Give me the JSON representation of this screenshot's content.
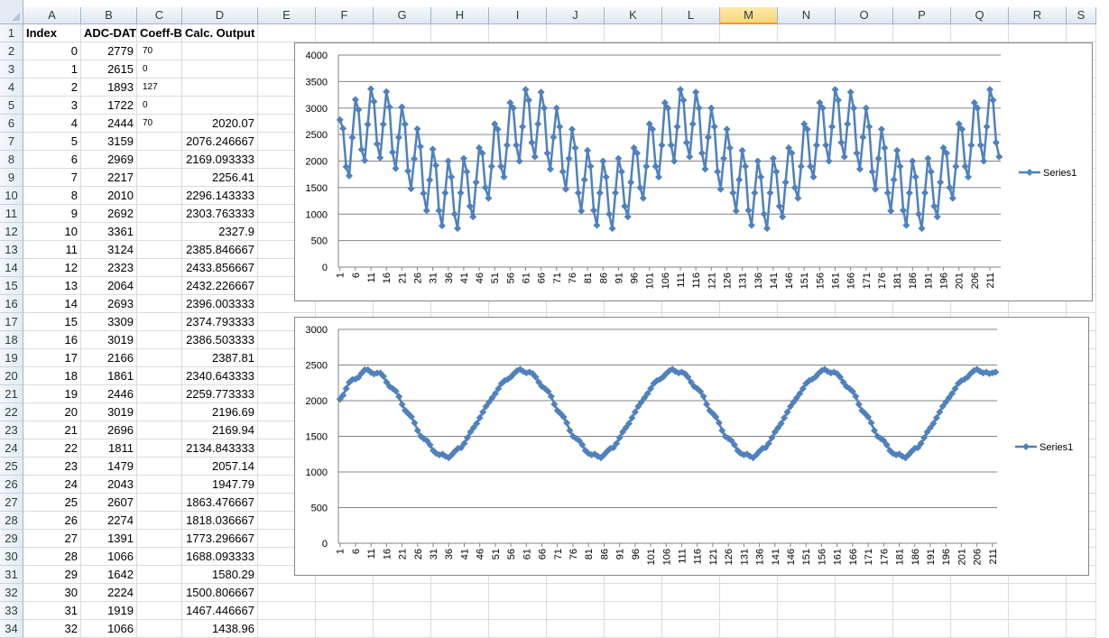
{
  "columns": [
    "A",
    "B",
    "C",
    "D",
    "E",
    "F",
    "G",
    "H",
    "I",
    "J",
    "K",
    "L",
    "M",
    "N",
    "O",
    "P",
    "Q",
    "R",
    "S"
  ],
  "active_column": "M",
  "headers": {
    "index": "Index",
    "adc": "ADC-DATA",
    "coeff": "Coeff-B",
    "calc": "Calc. Output"
  },
  "rows": [
    {
      "r": "1"
    },
    {
      "r": "2",
      "a": "0",
      "b": "2779",
      "c": "70",
      "d": ""
    },
    {
      "r": "3",
      "a": "1",
      "b": "2615",
      "c": "0",
      "d": ""
    },
    {
      "r": "4",
      "a": "2",
      "b": "1893",
      "c": "127",
      "d": ""
    },
    {
      "r": "5",
      "a": "3",
      "b": "1722",
      "c": "0",
      "d": ""
    },
    {
      "r": "6",
      "a": "4",
      "b": "2444",
      "c": "70",
      "d": "2020.07"
    },
    {
      "r": "7",
      "a": "5",
      "b": "3159",
      "c": "",
      "d": "2076.246667"
    },
    {
      "r": "8",
      "a": "6",
      "b": "2969",
      "c": "",
      "d": "2169.093333"
    },
    {
      "r": "9",
      "a": "7",
      "b": "2217",
      "c": "",
      "d": "2256.41"
    },
    {
      "r": "10",
      "a": "8",
      "b": "2010",
      "c": "",
      "d": "2296.143333"
    },
    {
      "r": "11",
      "a": "9",
      "b": "2692",
      "c": "",
      "d": "2303.763333"
    },
    {
      "r": "12",
      "a": "10",
      "b": "3361",
      "c": "",
      "d": "2327.9"
    },
    {
      "r": "13",
      "a": "11",
      "b": "3124",
      "c": "",
      "d": "2385.846667"
    },
    {
      "r": "14",
      "a": "12",
      "b": "2323",
      "c": "",
      "d": "2433.856667"
    },
    {
      "r": "15",
      "a": "13",
      "b": "2064",
      "c": "",
      "d": "2432.226667"
    },
    {
      "r": "16",
      "a": "14",
      "b": "2693",
      "c": "",
      "d": "2396.003333"
    },
    {
      "r": "17",
      "a": "15",
      "b": "3309",
      "c": "",
      "d": "2374.793333"
    },
    {
      "r": "18",
      "a": "16",
      "b": "3019",
      "c": "",
      "d": "2386.503333"
    },
    {
      "r": "19",
      "a": "17",
      "b": "2166",
      "c": "",
      "d": "2387.81"
    },
    {
      "r": "20",
      "a": "18",
      "b": "1861",
      "c": "",
      "d": "2340.643333"
    },
    {
      "r": "21",
      "a": "19",
      "b": "2446",
      "c": "",
      "d": "2259.773333"
    },
    {
      "r": "22",
      "a": "20",
      "b": "3019",
      "c": "",
      "d": "2196.69"
    },
    {
      "r": "23",
      "a": "21",
      "b": "2696",
      "c": "",
      "d": "2169.94"
    },
    {
      "r": "24",
      "a": "22",
      "b": "1811",
      "c": "",
      "d": "2134.843333"
    },
    {
      "r": "25",
      "a": "23",
      "b": "1479",
      "c": "",
      "d": "2057.14"
    },
    {
      "r": "26",
      "a": "24",
      "b": "2043",
      "c": "",
      "d": "1947.79"
    },
    {
      "r": "27",
      "a": "25",
      "b": "2607",
      "c": "",
      "d": "1863.476667"
    },
    {
      "r": "28",
      "a": "26",
      "b": "2274",
      "c": "",
      "d": "1818.036667"
    },
    {
      "r": "29",
      "a": "27",
      "b": "1391",
      "c": "",
      "d": "1773.296667"
    },
    {
      "r": "30",
      "a": "28",
      "b": "1066",
      "c": "",
      "d": "1688.093333"
    },
    {
      "r": "31",
      "a": "29",
      "b": "1642",
      "c": "",
      "d": "1580.29"
    },
    {
      "r": "32",
      "a": "30",
      "b": "2224",
      "c": "",
      "d": "1500.806667"
    },
    {
      "r": "33",
      "a": "31",
      "b": "1919",
      "c": "",
      "d": "1467.446667"
    },
    {
      "r": "34",
      "a": "32",
      "b": "1066",
      "c": "",
      "d": "1438.96"
    }
  ],
  "colors": {
    "series": "#4f81bd",
    "grid": "#868686",
    "header_bg": "#e4ebf4",
    "active_header": "#f9d67a"
  },
  "chart_data": [
    {
      "type": "line",
      "series": [
        {
          "name": "Series1",
          "values": [
            2779,
            2615,
            1893,
            1722,
            2444,
            3159,
            2969,
            2217,
            2010,
            2692,
            3361,
            3124,
            2323,
            2064,
            2693,
            3309,
            3019,
            2166,
            1861,
            2446,
            3019,
            2696,
            1811,
            1479,
            2043,
            2607,
            2274,
            1391,
            1066,
            1642,
            2224,
            1919,
            1066,
            780,
            1400,
            2000,
            1700,
            1000,
            730,
            1400,
            2050,
            1800,
            1150,
            950,
            1600,
            2250,
            2150,
            1500,
            1300,
            1900,
            2700,
            2600,
            1900,
            1700,
            2300,
            3100,
            3000,
            2300,
            2000,
            2650,
            3350,
            3150,
            2350,
            2080,
            2700,
            3300,
            3000,
            2150,
            1850,
            2450,
            3000,
            2650,
            1800,
            1470,
            2050,
            2600,
            2250,
            1400,
            1060,
            1650,
            2200,
            1900,
            1070,
            790,
            1400,
            2000,
            1700,
            1000,
            730,
            1400,
            2050,
            1800,
            1150,
            950,
            1600,
            2250,
            2150,
            1500,
            1300,
            1900,
            2700,
            2600,
            1900,
            1700,
            2300,
            3100,
            3000,
            2300,
            2000,
            2650,
            3350,
            3150,
            2350,
            2080,
            2700,
            3300,
            3000,
            2150,
            1850,
            2450,
            3000,
            2650,
            1800,
            1470,
            2050,
            2600,
            2250,
            1400,
            1060,
            1650,
            2200,
            1900,
            1070,
            790,
            1400,
            2000,
            1700,
            1000,
            730,
            1400,
            2050,
            1800,
            1150,
            950,
            1600,
            2250,
            2150,
            1500,
            1300,
            1900,
            2700,
            2600,
            1900,
            1700,
            2300,
            3100,
            3000,
            2300,
            2000,
            2650,
            3350,
            3150,
            2350,
            2080,
            2700,
            3300,
            3000,
            2150,
            1850,
            2450,
            3000,
            2650,
            1800,
            1470,
            2050,
            2600,
            2250,
            1400,
            1060,
            1650,
            2200,
            1900,
            1070,
            790,
            1400,
            2000,
            1700,
            1000,
            730,
            1400,
            2050,
            1800,
            1150,
            950,
            1600,
            2250,
            2150,
            1500,
            1300,
            1900,
            2700,
            2600,
            1900,
            1700,
            2300,
            3100,
            3000,
            2300,
            2000,
            2650,
            3350,
            3150,
            2350,
            2080
          ]
        }
      ],
      "ylim": [
        0,
        4000
      ],
      "yticks": [
        0,
        500,
        1000,
        1500,
        2000,
        2500,
        3000,
        3500,
        4000
      ],
      "xticks": [
        1,
        6,
        11,
        16,
        21,
        26,
        31,
        36,
        41,
        46,
        51,
        56,
        61,
        66,
        71,
        76,
        81,
        86,
        91,
        96,
        101,
        106,
        111,
        116,
        121,
        126,
        131,
        136,
        141,
        146,
        151,
        156,
        161,
        166,
        171,
        176,
        181,
        186,
        191,
        196,
        201,
        206,
        211
      ],
      "grid": true,
      "legend": "right"
    },
    {
      "type": "line",
      "series": [
        {
          "name": "Series1",
          "values": [
            2020,
            2076,
            2169,
            2256,
            2296,
            2304,
            2328,
            2386,
            2434,
            2432,
            2396,
            2375,
            2387,
            2388,
            2341,
            2260,
            2197,
            2170,
            2135,
            2057,
            1948,
            1863,
            1818,
            1773,
            1688,
            1580,
            1501,
            1467,
            1439,
            1380,
            1300,
            1260,
            1240,
            1250,
            1220,
            1200,
            1240,
            1290,
            1330,
            1340,
            1400,
            1480,
            1560,
            1620,
            1680,
            1760,
            1840,
            1920,
            1980,
            2040,
            2100,
            2170,
            2240,
            2280,
            2300,
            2330,
            2380,
            2420,
            2440,
            2410,
            2390,
            2400,
            2380,
            2330,
            2260,
            2200,
            2170,
            2130,
            2060,
            1950,
            1860,
            1820,
            1770,
            1690,
            1580,
            1500,
            1470,
            1440,
            1380,
            1300,
            1260,
            1240,
            1250,
            1220,
            1200,
            1240,
            1290,
            1330,
            1340,
            1400,
            1480,
            1560,
            1620,
            1680,
            1760,
            1840,
            1920,
            1980,
            2040,
            2100,
            2170,
            2240,
            2280,
            2300,
            2330,
            2380,
            2420,
            2440,
            2410,
            2390,
            2400,
            2380,
            2330,
            2260,
            2200,
            2170,
            2130,
            2060,
            1950,
            1860,
            1820,
            1770,
            1690,
            1580,
            1500,
            1470,
            1440,
            1380,
            1300,
            1260,
            1240,
            1250,
            1220,
            1200,
            1240,
            1290,
            1330,
            1340,
            1400,
            1480,
            1560,
            1620,
            1680,
            1760,
            1840,
            1920,
            1980,
            2040,
            2100,
            2170,
            2240,
            2280,
            2300,
            2330,
            2380,
            2420,
            2440,
            2410,
            2390,
            2400,
            2380,
            2330,
            2260,
            2200,
            2170,
            2130,
            2060,
            1950,
            1860,
            1820,
            1770,
            1690,
            1580,
            1500,
            1470,
            1440,
            1380,
            1300,
            1260,
            1240,
            1250,
            1220,
            1200,
            1240,
            1290,
            1330,
            1340,
            1400,
            1480,
            1560,
            1620,
            1680,
            1760,
            1840,
            1920,
            1980,
            2040,
            2100,
            2170,
            2240,
            2280,
            2300,
            2330,
            2380,
            2420,
            2440,
            2410,
            2390,
            2400,
            2380,
            2390,
            2400
          ]
        }
      ],
      "ylim": [
        0,
        3000
      ],
      "yticks": [
        0,
        500,
        1000,
        1500,
        2000,
        2500,
        3000
      ],
      "xticks": [
        1,
        6,
        11,
        16,
        21,
        26,
        31,
        36,
        41,
        46,
        51,
        56,
        61,
        66,
        71,
        76,
        81,
        86,
        91,
        96,
        101,
        106,
        111,
        116,
        121,
        126,
        131,
        136,
        141,
        146,
        151,
        156,
        161,
        166,
        171,
        176,
        181,
        186,
        191,
        196,
        201,
        206,
        211
      ],
      "grid": true,
      "legend": "right"
    }
  ]
}
